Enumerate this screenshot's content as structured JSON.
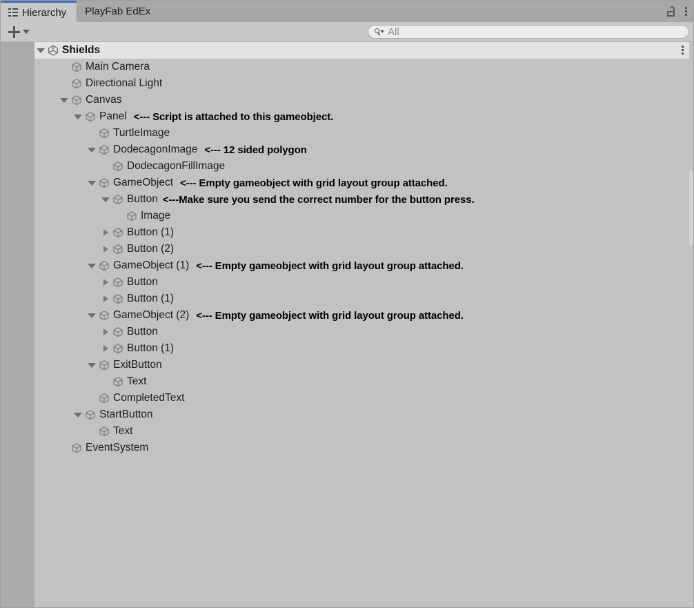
{
  "window": {
    "tabs": [
      {
        "label": "Hierarchy",
        "icon": "hierarchy-icon",
        "active": true
      },
      {
        "label": "PlayFab EdEx",
        "icon": "",
        "active": false
      }
    ],
    "lock_icon": "lock-icon",
    "menu_icon": "kebab-menu-icon"
  },
  "toolbar": {
    "add_label": "+",
    "add_icon": "plus-icon",
    "add_dropdown_icon": "chevron-down-icon",
    "search": {
      "icon": "search-icon",
      "placeholder": "All",
      "value": ""
    }
  },
  "hierarchy": {
    "root": {
      "name": "Shields",
      "icon": "unity-scene-icon",
      "expanded": true,
      "row_menu_icon": "kebab-menu-icon"
    },
    "rows": [
      {
        "name": "Main Camera",
        "depth": 1,
        "fold": "none",
        "note": ""
      },
      {
        "name": "Directional Light",
        "depth": 1,
        "fold": "none",
        "note": ""
      },
      {
        "name": "Canvas",
        "depth": 1,
        "fold": "expanded",
        "note": ""
      },
      {
        "name": "Panel",
        "depth": 2,
        "fold": "expanded",
        "note": "<--- Script is attached to this gameobject."
      },
      {
        "name": "TurtleImage",
        "depth": 3,
        "fold": "none",
        "note": ""
      },
      {
        "name": "DodecagonImage",
        "depth": 3,
        "fold": "expanded",
        "note": "<--- 12 sided polygon"
      },
      {
        "name": "DodecagonFillImage",
        "depth": 4,
        "fold": "none",
        "note": ""
      },
      {
        "name": "GameObject",
        "depth": 3,
        "fold": "expanded",
        "note": "<--- Empty gameobject with grid layout group attached."
      },
      {
        "name": "Button",
        "depth": 4,
        "fold": "expanded",
        "note": "<---Make sure you send the correct number for the button press."
      },
      {
        "name": "Image",
        "depth": 5,
        "fold": "none",
        "note": ""
      },
      {
        "name": "Button (1)",
        "depth": 4,
        "fold": "collapsed",
        "note": ""
      },
      {
        "name": "Button (2)",
        "depth": 4,
        "fold": "collapsed",
        "note": ""
      },
      {
        "name": "GameObject (1)",
        "depth": 3,
        "fold": "expanded",
        "note": "<--- Empty gameobject with grid layout group attached."
      },
      {
        "name": "Button",
        "depth": 4,
        "fold": "collapsed",
        "note": ""
      },
      {
        "name": "Button (1)",
        "depth": 4,
        "fold": "collapsed",
        "note": ""
      },
      {
        "name": "GameObject (2)",
        "depth": 3,
        "fold": "expanded",
        "note": "<--- Empty gameobject with grid layout group attached."
      },
      {
        "name": "Button",
        "depth": 4,
        "fold": "collapsed",
        "note": ""
      },
      {
        "name": "Button (1)",
        "depth": 4,
        "fold": "collapsed",
        "note": ""
      },
      {
        "name": "ExitButton",
        "depth": 3,
        "fold": "expanded",
        "note": ""
      },
      {
        "name": "Text",
        "depth": 4,
        "fold": "none",
        "note": ""
      },
      {
        "name": "CompletedText",
        "depth": 3,
        "fold": "none",
        "note": ""
      },
      {
        "name": "StartButton",
        "depth": 2,
        "fold": "expanded",
        "note": ""
      },
      {
        "name": "Text",
        "depth": 3,
        "fold": "none",
        "note": ""
      },
      {
        "name": "EventSystem",
        "depth": 1,
        "fold": "none",
        "note": ""
      }
    ]
  },
  "colors": {
    "panel_bg": "#c2c2c2",
    "tabbar_bg": "#a8a8a8",
    "active_tab_bg": "#c8c8c8",
    "accent": "#3b6fb5",
    "selected_row_bg": "#e3e3e3",
    "gutter": "#ababab"
  }
}
